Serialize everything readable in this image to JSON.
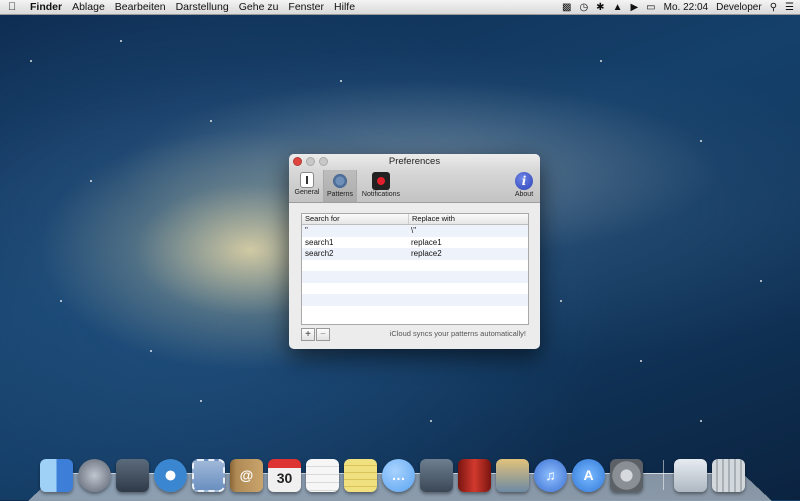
{
  "menubar": {
    "apple": "",
    "items": [
      "Finder",
      "Ablage",
      "Bearbeiten",
      "Darstellung",
      "Gehe zu",
      "Fenster",
      "Hilfe"
    ],
    "clock": "Mo. 22:04",
    "user": "Developer"
  },
  "window": {
    "title": "Preferences",
    "toolbar": [
      {
        "label": "General",
        "icon": "general-icon"
      },
      {
        "label": "Patterns",
        "icon": "gear-icon",
        "selected": true
      },
      {
        "label": "Notifications",
        "icon": "record-icon"
      },
      {
        "label": "About",
        "icon": "info-icon"
      }
    ],
    "table": {
      "headers": [
        "Search for",
        "Replace with"
      ],
      "rows": [
        [
          "\"",
          "\\\""
        ],
        [
          "search1",
          "replace1"
        ],
        [
          "search2",
          "replace2"
        ]
      ]
    },
    "add_label": "+",
    "remove_label": "−",
    "sync_note": "iCloud syncs your patterns automatically!"
  },
  "dock": {
    "apps": [
      {
        "name": "finder-icon",
        "color": "#3d7fd8"
      },
      {
        "name": "launchpad-icon",
        "color": "#5a6270"
      },
      {
        "name": "mission-control-icon",
        "color": "#2f3a48"
      },
      {
        "name": "safari-icon",
        "color": "#3a86d0"
      },
      {
        "name": "mail-stamp-icon",
        "color": "#6a8fc0"
      },
      {
        "name": "contacts-icon",
        "color": "#b08a55"
      },
      {
        "name": "calendar-icon",
        "color": "#f0f0f0"
      },
      {
        "name": "reminders-icon",
        "color": "#f6f6f6"
      },
      {
        "name": "notes-icon",
        "color": "#e8d36a"
      },
      {
        "name": "messages-icon",
        "color": "#5aa4f0"
      },
      {
        "name": "facetime-icon",
        "color": "#4b5a68"
      },
      {
        "name": "photo-booth-icon",
        "color": "#b3261e"
      },
      {
        "name": "iphoto-icon",
        "color": "#6d8aa4"
      },
      {
        "name": "itunes-icon",
        "color": "#3b6fd1"
      },
      {
        "name": "app-store-icon",
        "color": "#2f79d8"
      },
      {
        "name": "system-preferences-icon",
        "color": "#8a8f96"
      },
      {
        "name": "downloads-stack-icon",
        "color": "#cfd6dd"
      },
      {
        "name": "trash-icon",
        "color": "#b9c0c6"
      }
    ],
    "calendar_day": "30"
  }
}
